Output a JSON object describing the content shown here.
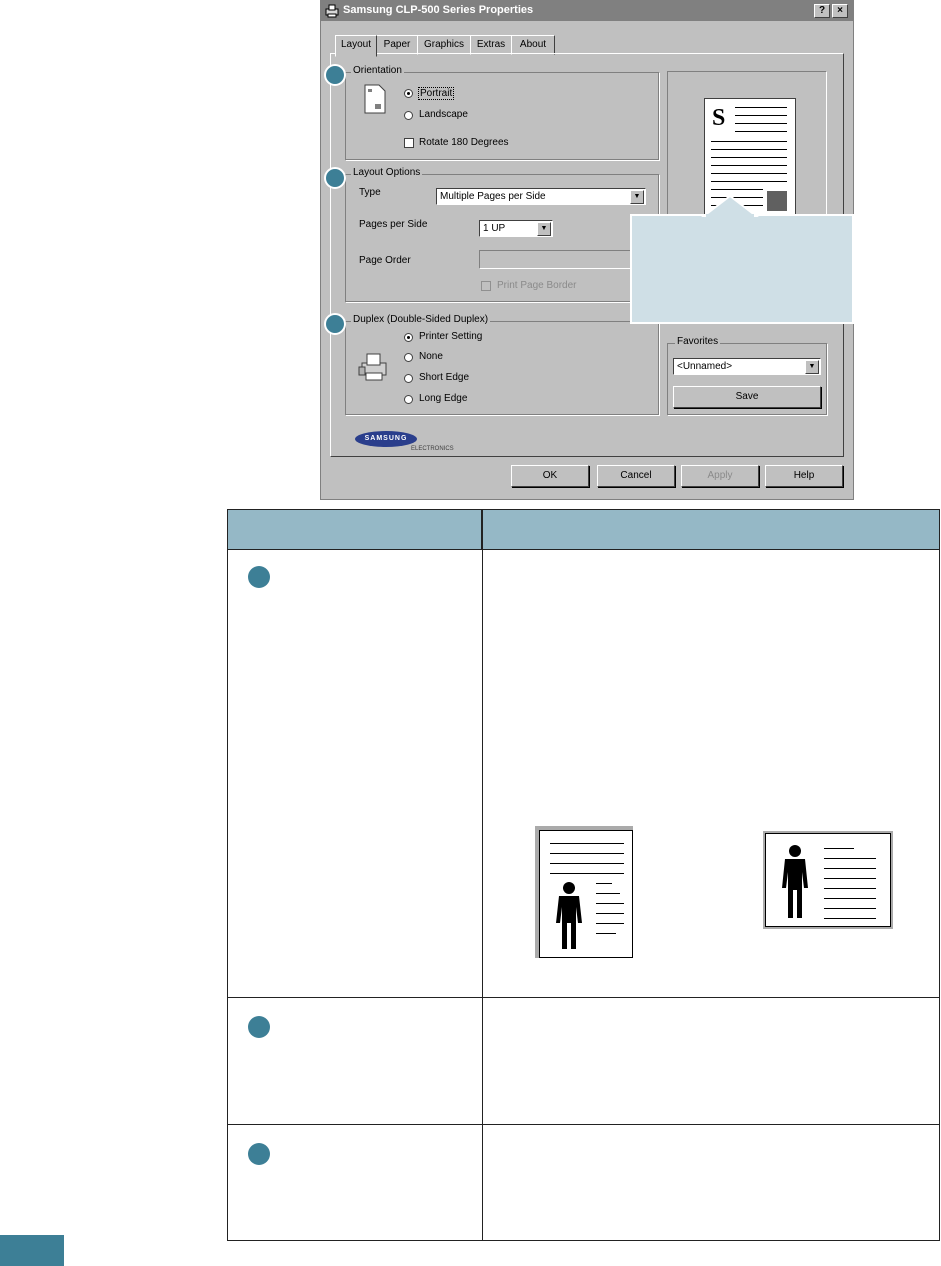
{
  "dialog": {
    "title": "Samsung CLP-500 Series Properties",
    "help_btn": "?",
    "close_btn": "×",
    "tabs": [
      {
        "label": "Layout"
      },
      {
        "label": "Paper"
      },
      {
        "label": "Graphics"
      },
      {
        "label": "Extras"
      },
      {
        "label": "About"
      }
    ],
    "orientation": {
      "legend": "Orientation",
      "portrait": "Portrait",
      "landscape": "Landscape",
      "rotate": "Rotate 180 Degrees",
      "selected": "Portrait"
    },
    "layout_options": {
      "legend": "Layout Options",
      "type_label": "Type",
      "type_value": "Multiple Pages per Side",
      "pages_label": "Pages per Side",
      "pages_value": "1 UP",
      "order_label": "Page Order",
      "border_label": "Print Page Border"
    },
    "duplex": {
      "legend": "Duplex (Double-Sided Duplex)",
      "options": [
        "Printer Setting",
        "None",
        "Short Edge",
        "Long Edge"
      ],
      "selected": "Printer Setting"
    },
    "preview_letter": "S",
    "favorites": {
      "legend": "Favorites",
      "value": "<Unnamed>",
      "save": "Save"
    },
    "logo": {
      "brand": "SAMSUNG",
      "sub": "ELECTRONICS"
    },
    "buttons": {
      "ok": "OK",
      "cancel": "Cancel",
      "apply": "Apply",
      "help": "Help"
    }
  },
  "colors": {
    "marker": "#3d7f96",
    "table_header": "#95b8c6",
    "callout": "#cfdfe6",
    "dialog_bg": "#c0c0c0"
  }
}
